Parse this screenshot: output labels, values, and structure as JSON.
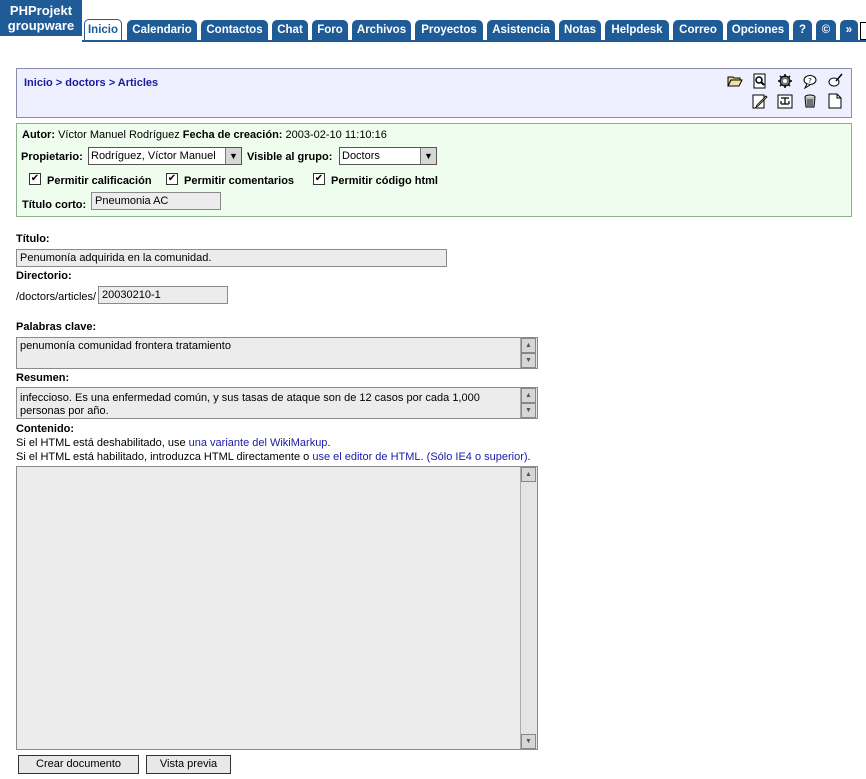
{
  "app": {
    "logo_line1": "PHProjekt",
    "logo_line2": "groupware"
  },
  "tabs": [
    {
      "label": "Inicio",
      "active": true
    },
    {
      "label": "Calendario"
    },
    {
      "label": "Contactos"
    },
    {
      "label": "Chat"
    },
    {
      "label": "Foro"
    },
    {
      "label": "Archivos"
    },
    {
      "label": "Proyectos"
    },
    {
      "label": "Asistencia"
    },
    {
      "label": "Notas"
    },
    {
      "label": "Helpdesk"
    },
    {
      "label": "Correo"
    },
    {
      "label": "Opciones"
    },
    {
      "label": "?"
    },
    {
      "label": "©"
    },
    {
      "label": "»"
    }
  ],
  "breadcrumb": {
    "home": "Inicio",
    "sep": ">",
    "folder": "doctors",
    "current": "Articles"
  },
  "toolbar_icons": [
    "folder-open-icon",
    "search-icon",
    "gear-icon",
    "speech-bubble-icon",
    "quill-icon",
    "edit-icon",
    "tree-icon",
    "trash-icon",
    "new-document-icon"
  ],
  "meta": {
    "author_label": "Autor:",
    "author_value": "Víctor Manuel Rodríguez",
    "created_label": "Fecha de creación:",
    "created_value": "2003-02-10 11:10:16",
    "owner_label": "Propietario:",
    "owner_value": "Rodríguez, Víctor Manuel",
    "group_label": "Visible al grupo:",
    "group_value": "Doctors",
    "allow_rating": "Permitir calificación",
    "allow_comments": "Permitir comentarios",
    "allow_html": "Permitir código html",
    "short_title_label": "Título corto:",
    "short_title_value": "Pneumonia AC"
  },
  "form": {
    "title_label": "Título:",
    "title_value": "Penumonía adquirida en la comunidad.",
    "dir_label": "Directorio:",
    "dir_prefix": "/doctors/articles/",
    "dir_value": "20030210-1",
    "keywords_label": "Palabras clave:",
    "keywords_value": "penumonía comunidad frontera tratamiento",
    "summary_label": "Resumen:",
    "summary_line1": "infeccioso. Es una enfermedad común, y sus tasas de ataque son de 12 casos por cada 1,000",
    "summary_line2": "personas por año.",
    "content_label": "Contenido:",
    "hint1_prefix": "Si el HTML está deshabilitado, use ",
    "hint1_link": "una variante del WikiMarkup",
    "hint1_suffix": ".",
    "hint2_prefix": "Si el HTML está habilitado, introduzca HTML directamente o ",
    "hint2_link": "use el editor de HTML. (Sólo IE4 o superior)",
    "hint2_suffix": ".",
    "content_value": ""
  },
  "buttons": {
    "create": "Crear documento",
    "preview": "Vista previa"
  },
  "colors": {
    "brand": "#1f5b96",
    "link": "#1a1aa8",
    "crumb_bg": "#eef0ff",
    "meta_bg": "#eefdee"
  }
}
